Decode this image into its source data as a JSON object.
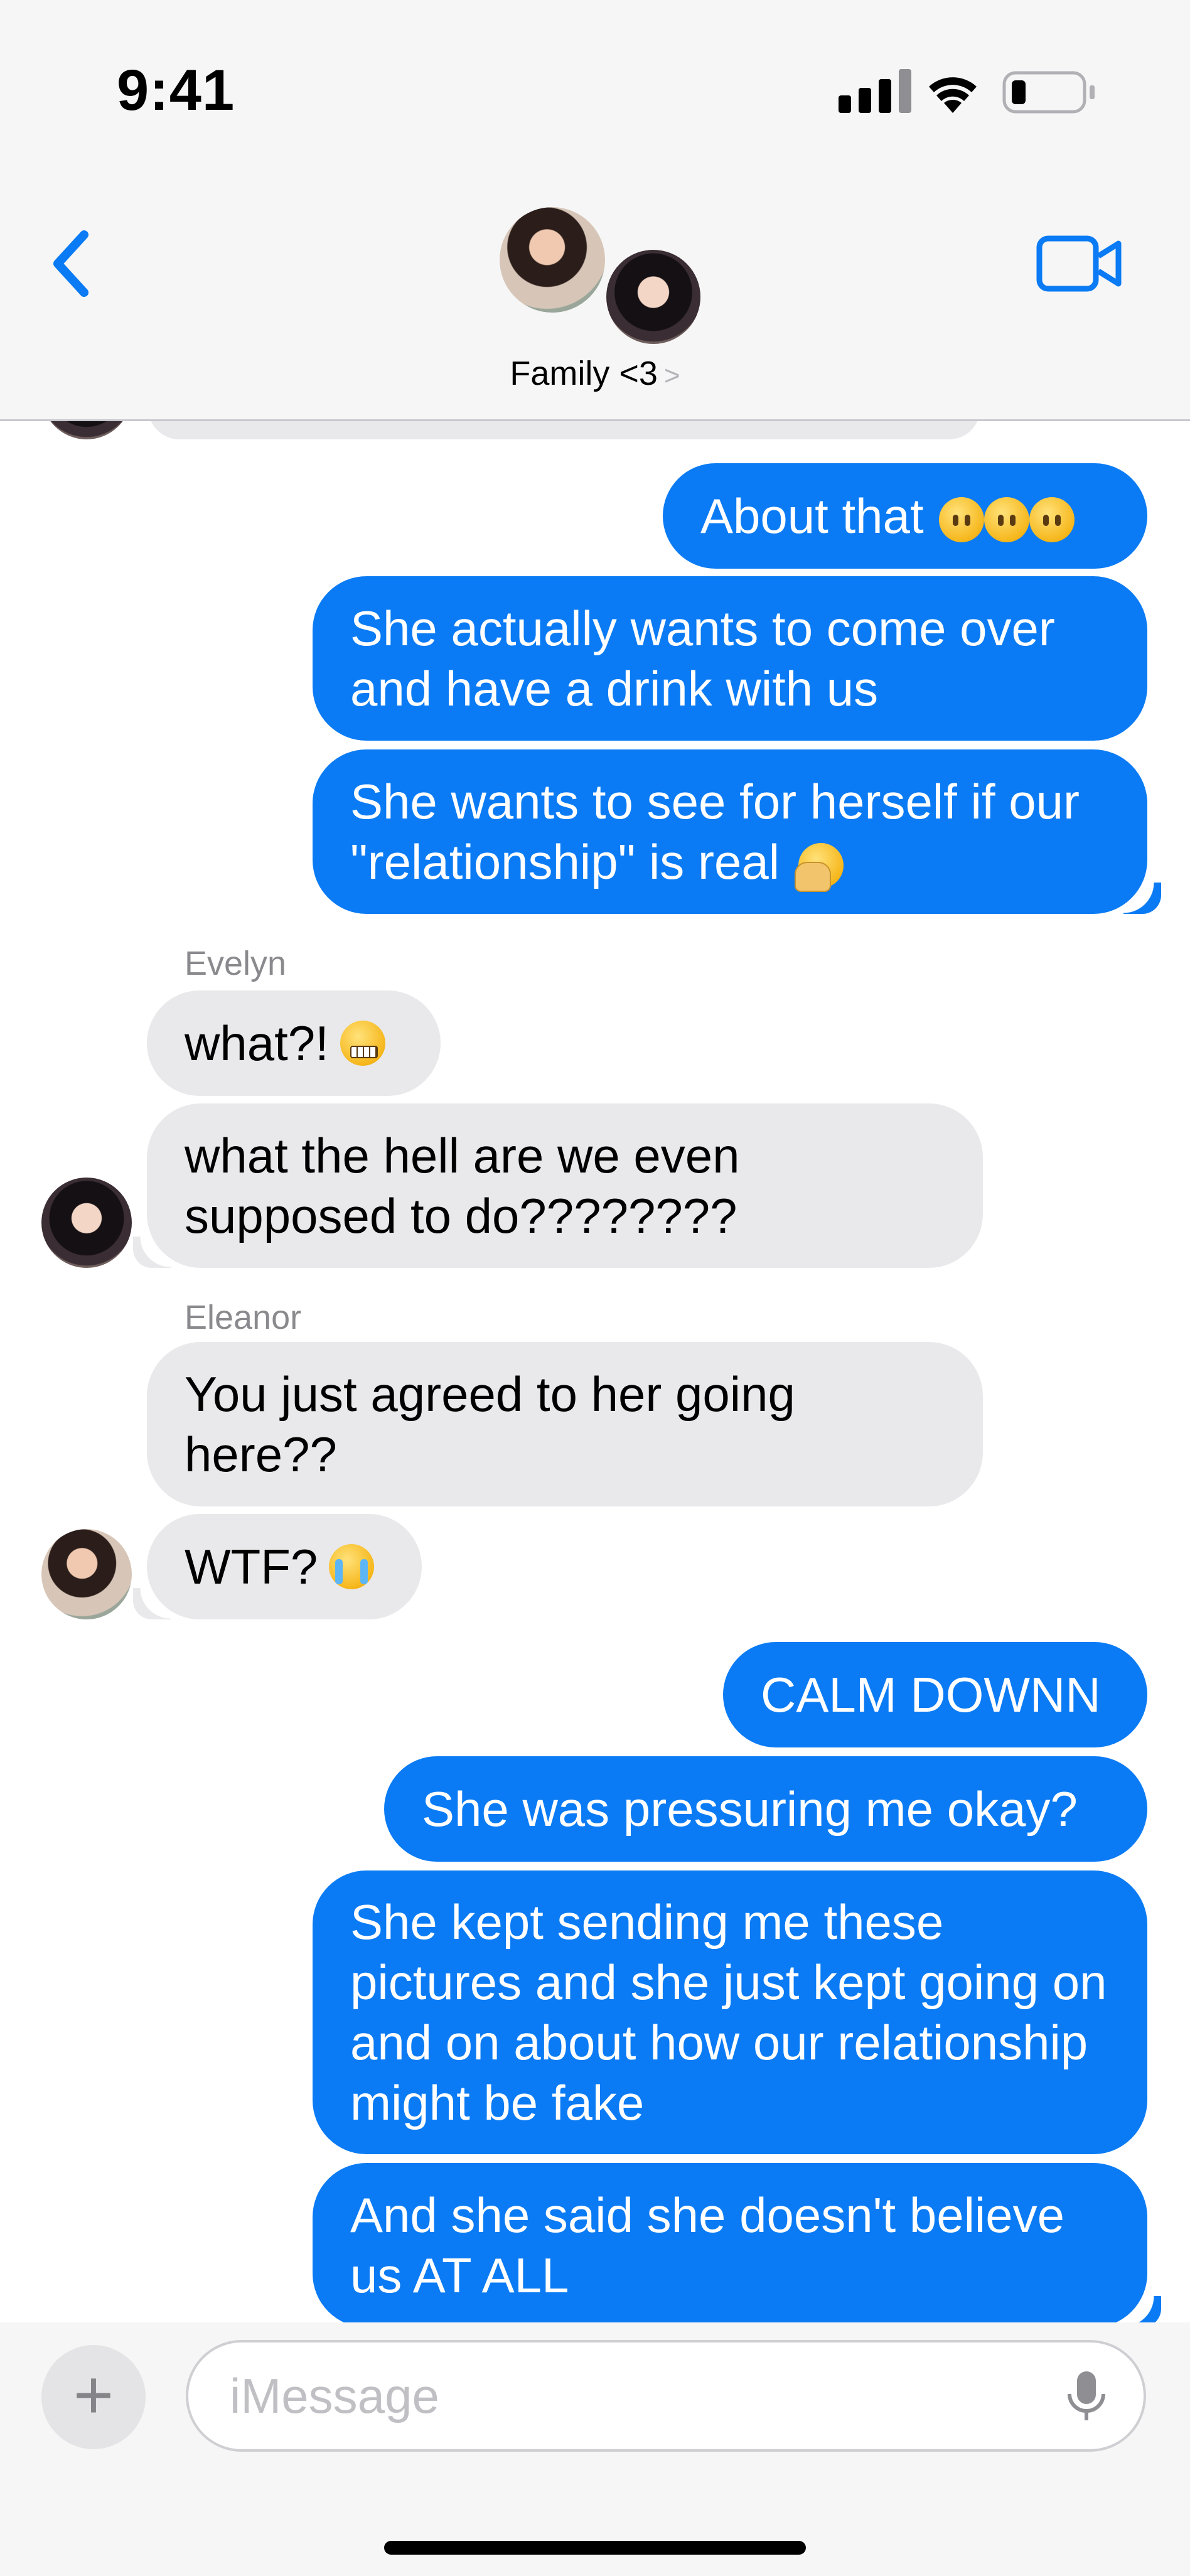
{
  "status_bar": {
    "time": "9:41"
  },
  "header": {
    "group_name": "Family <3",
    "chevron": ">"
  },
  "messages": [
    {
      "text": "About that",
      "emoji": "no-mouth-face x3"
    },
    {
      "text": "She actually wants to come over and have a drink with us"
    },
    {
      "text": "She wants to see for herself if our \"relationship\" is real",
      "emoji": "facepalm"
    },
    {
      "sender": "Evelyn"
    },
    {
      "text": "what?!",
      "emoji": "grimacing-face"
    },
    {
      "text": "what the hell are we even supposed to do????????"
    },
    {
      "sender": "Eleanor"
    },
    {
      "text": "You just agreed to her going here??"
    },
    {
      "text": "WTF?",
      "emoji": "crying-face"
    },
    {
      "text": "CALM DOWNN"
    },
    {
      "text": "She was pressuring me okay?"
    },
    {
      "text": "She kept sending me these pictures and she just kept going on and on about how our relationship might be fake"
    },
    {
      "text": "And she said she doesn't believe us AT ALL"
    }
  ],
  "composer": {
    "placeholder": "iMessage",
    "plus_label": "+"
  },
  "colors": {
    "outgoing": "#0a7bf4",
    "incoming": "#e9e9eb",
    "accent": "#0a7bf4"
  }
}
